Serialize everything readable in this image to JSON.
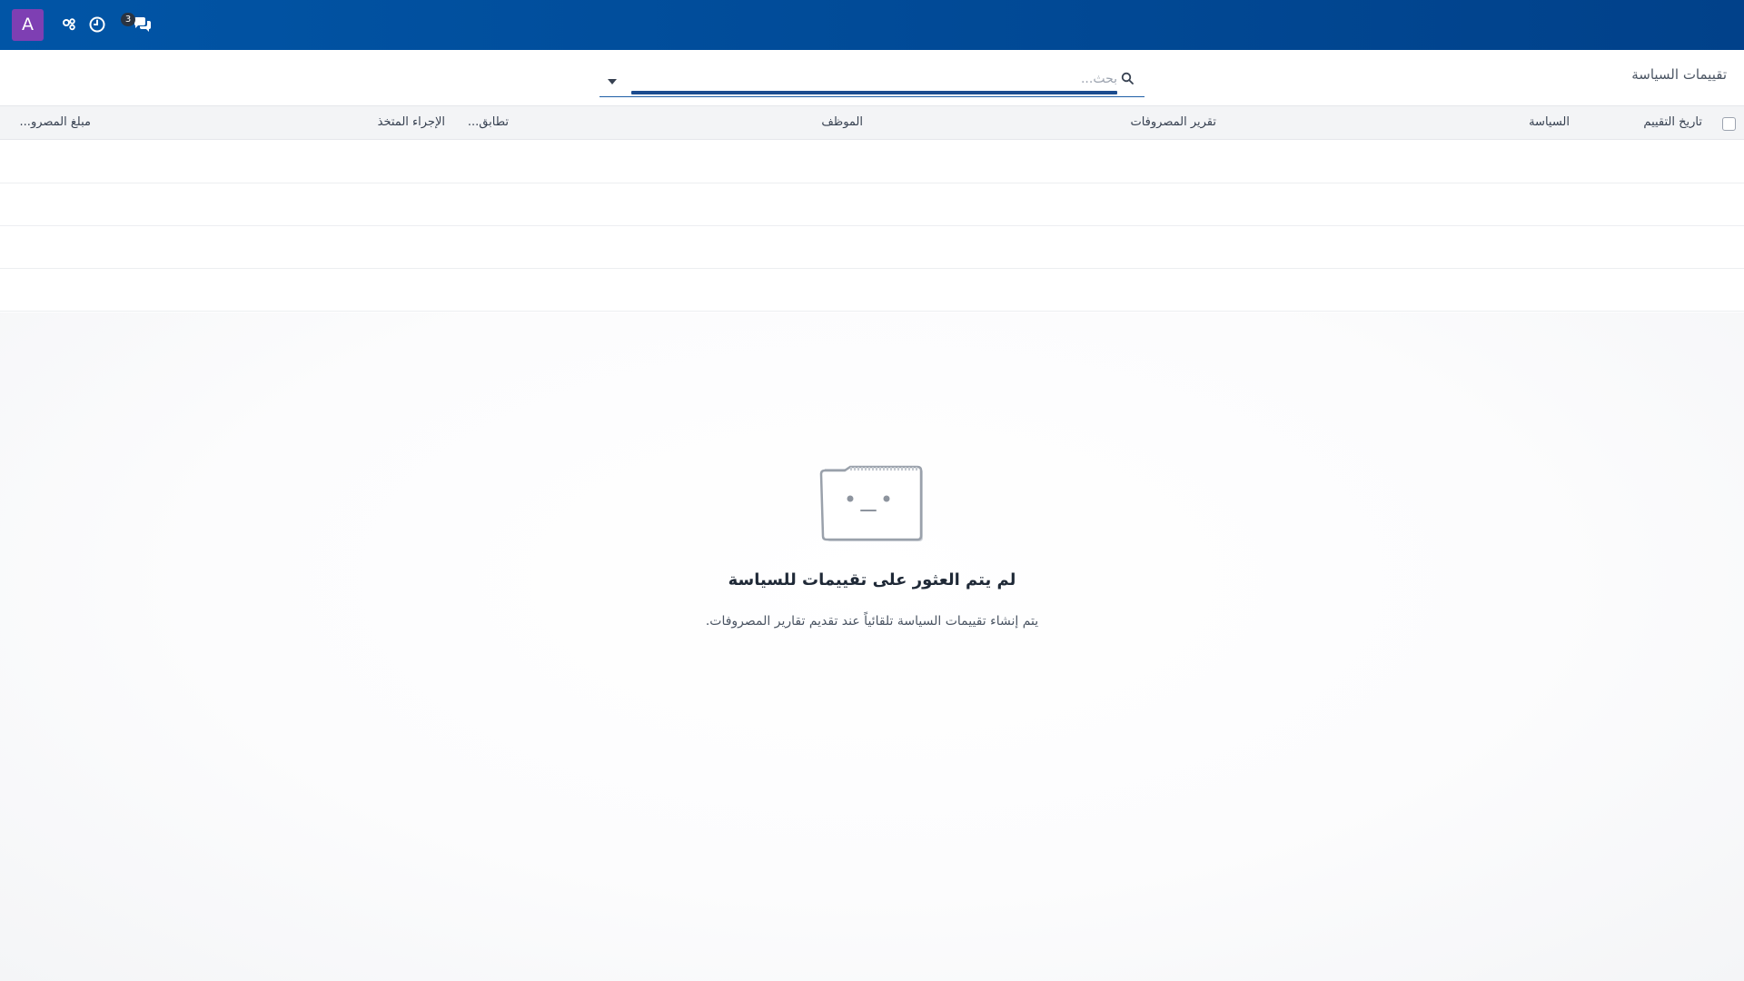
{
  "navbar": {
    "avatar_letter": "A",
    "chat_badge": "3",
    "icons": [
      "people-icon",
      "clock-icon",
      "chat-icon"
    ]
  },
  "control_panel": {
    "breadcrumb": "تقييمات السياسة",
    "search": {
      "placeholder": "بحث...",
      "value": ""
    }
  },
  "table": {
    "columns": [
      "تاريخ التقييم",
      "السياسة",
      "تقرير المصروفات",
      "الموظف",
      "تطابق...",
      "الإجراء المتخذ",
      "مبلغ المصرو..."
    ]
  },
  "empty_state": {
    "title": "لم يتم العثور على تقييمات للسياسة",
    "description": "يتم إنشاء تقييمات السياسة تلقائياً عند تقديم تقارير المصروفات."
  },
  "colors": {
    "navbar_start": "#0155a6",
    "navbar_end": "#01418a",
    "avatar": "#7e3fb3",
    "search_accent": "#1c4c8f"
  }
}
